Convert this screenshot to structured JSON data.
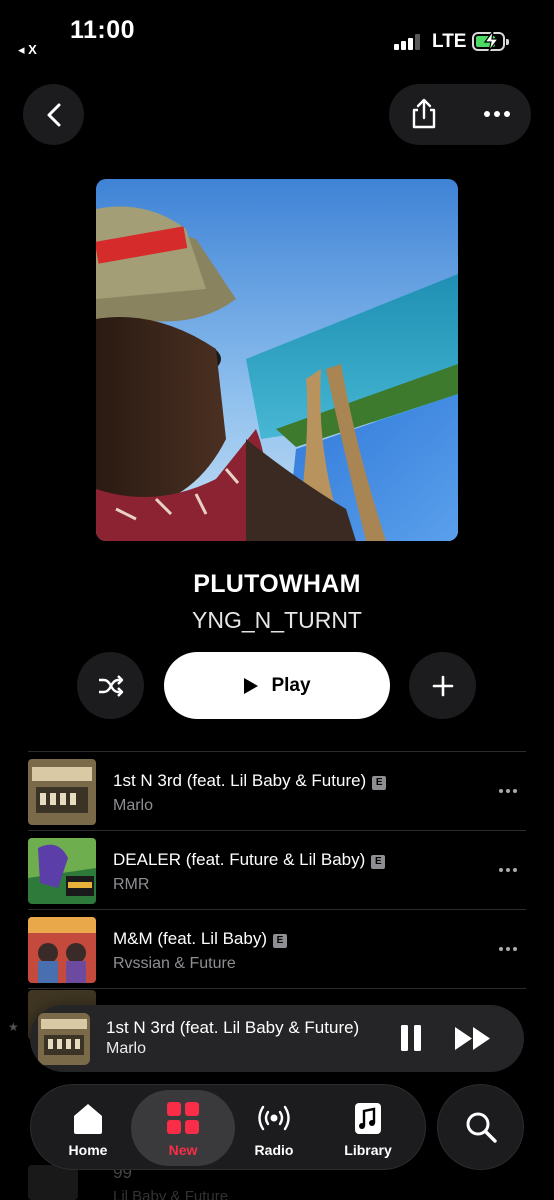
{
  "status": {
    "time": "11:00",
    "back_app": "◂ X",
    "network": "LTE"
  },
  "album": {
    "title": "PLUTOWHAM",
    "artist": "YNG_N_TURNT"
  },
  "controls": {
    "play_label": "Play"
  },
  "tracks": [
    {
      "title": "1st N 3rd (feat. Lil Baby & Future)",
      "explicit": "E",
      "artist": "Marlo"
    },
    {
      "title": "DEALER (feat. Future & Lil Baby)",
      "explicit": "E",
      "artist": "RMR"
    },
    {
      "title": "M&M (feat. Lil Baby)",
      "explicit": "E",
      "artist": "Rvssian & Future"
    }
  ],
  "background_rows": {
    "track_title": "99",
    "track_artist": "Lil Baby & Future"
  },
  "mini_player": {
    "title": "1st N 3rd (feat. Lil Baby & Future)",
    "artist": "Marlo"
  },
  "tabs": [
    {
      "label": "Home",
      "icon": "home-icon"
    },
    {
      "label": "New",
      "icon": "grid-icon",
      "active": true
    },
    {
      "label": "Radio",
      "icon": "radio-icon"
    },
    {
      "label": "Library",
      "icon": "library-icon"
    }
  ],
  "colors": {
    "accent": "#fa2d48",
    "background": "#000000",
    "surface": "#1c1c1e",
    "secondary_text": "#8e8e93",
    "battery": "#4cd964"
  }
}
